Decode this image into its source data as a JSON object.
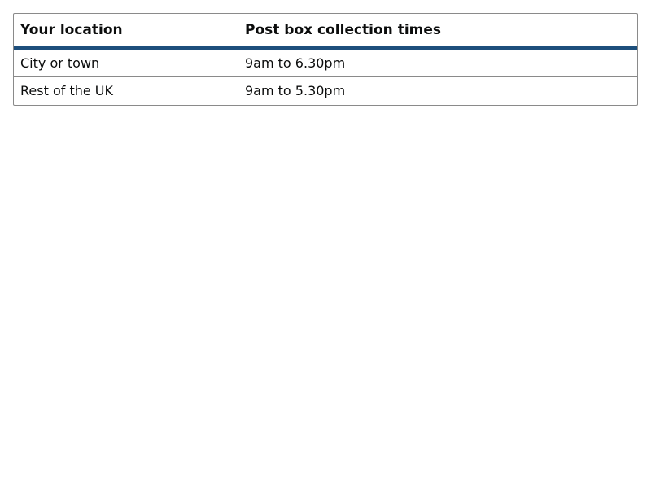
{
  "table": {
    "headers": [
      "Your location",
      "Post box collection times"
    ],
    "rows": [
      [
        "City or town",
        "9am to 6.30pm"
      ],
      [
        "Rest of the UK",
        "9am to 5.30pm"
      ]
    ]
  },
  "colors": {
    "header_rule": "#1d4f7c",
    "border": "#8a8a8a",
    "text": "#0b0c0c"
  }
}
